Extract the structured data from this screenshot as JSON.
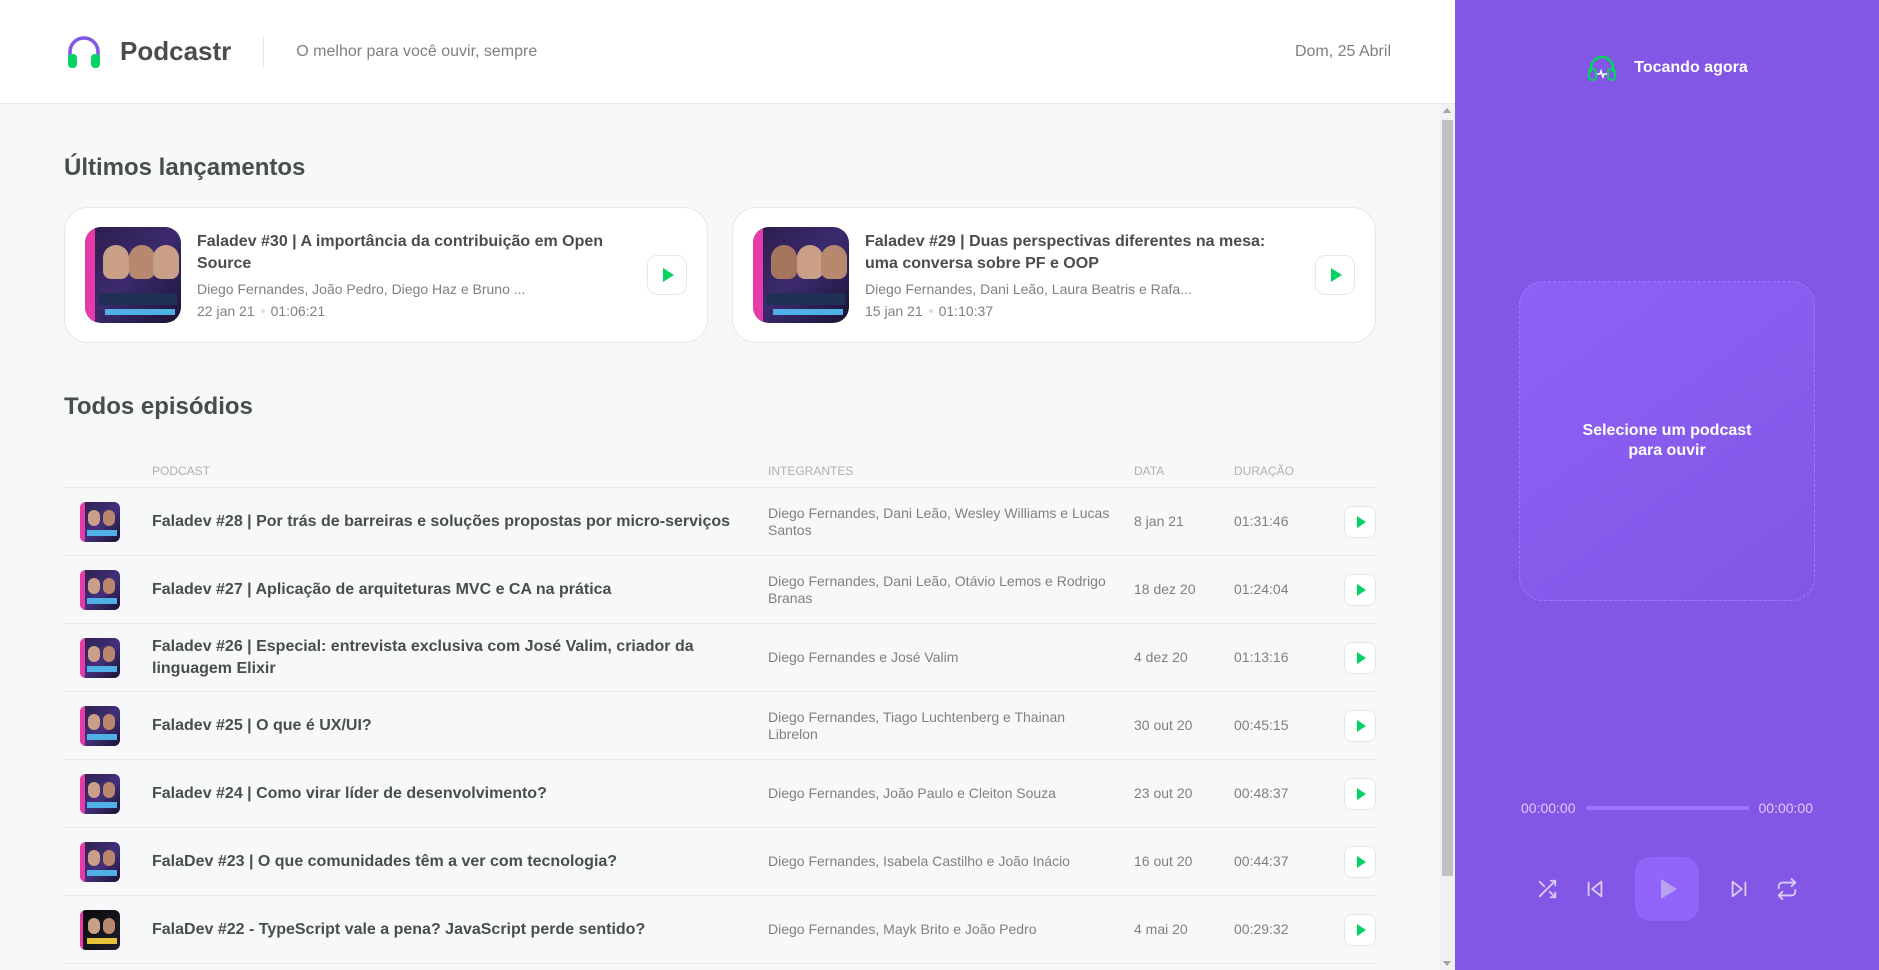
{
  "header": {
    "app_name": "Podcastr",
    "tagline": "O melhor para você ouvir, sempre",
    "date": "Dom, 25 Abril"
  },
  "latest": {
    "title": "Últimos lançamentos",
    "episodes": [
      {
        "title": "Faladev #30 | A importância da contribuição em Open Source",
        "members": "Diego Fernandes, João Pedro, Diego Haz e Bruno ...",
        "date": "22 jan 21",
        "duration": "01:06:21"
      },
      {
        "title": "Faladev #29 | Duas perspectivas diferentes na mesa: uma conversa sobre PF e OOP",
        "members": "Diego Fernandes, Dani Leão, Laura Beatris e Rafa...",
        "date": "15 jan 21",
        "duration": "01:10:37"
      }
    ]
  },
  "all": {
    "title": "Todos episódios",
    "headers": {
      "podcast": "Podcast",
      "members": "Integrantes",
      "date": "Data",
      "duration": "Duração"
    },
    "rows": [
      {
        "title": "Faladev #28 | Por trás de barreiras e soluções propostas por micro-serviços",
        "members": "Diego Fernandes, Dani Leão, Wesley Williams e Lucas Santos",
        "date": "8 jan 21",
        "duration": "01:31:46"
      },
      {
        "title": "Faladev #27 | Aplicação de arquiteturas MVC e CA na prática",
        "members": "Diego Fernandes, Dani Leão, Otávio Lemos e Rodrigo Branas",
        "date": "18 dez 20",
        "duration": "01:24:04"
      },
      {
        "title": "Faladev #26 | Especial: entrevista exclusiva com José Valim, criador da linguagem Elixir",
        "members": "Diego Fernandes e José Valim",
        "date": "4 dez 20",
        "duration": "01:13:16"
      },
      {
        "title": "Faladev #25 | O que é UX/UI?",
        "members": "Diego Fernandes, Tiago Luchtenberg e Thainan Librelon",
        "date": "30 out 20",
        "duration": "00:45:15"
      },
      {
        "title": "Faladev #24 | Como virar líder de desenvolvimento?",
        "members": "Diego Fernandes, João Paulo e Cleiton Souza",
        "date": "23 out 20",
        "duration": "00:48:37"
      },
      {
        "title": "FalaDev #23 | O que comunidades têm a ver com tecnologia?",
        "members": "Diego Fernandes, Isabela Castilho e João Inácio",
        "date": "16 out 20",
        "duration": "00:44:37"
      },
      {
        "title": "FalaDev #22 - TypeScript vale a pena? JavaScript perde sentido?",
        "members": "Diego Fernandes, Mayk Brito e João Pedro",
        "date": "4 mai 20",
        "duration": "00:29:32"
      }
    ]
  },
  "player": {
    "title": "Tocando agora",
    "empty_message": "Selecione um podcast para ouvir",
    "current_time": "00:00:00",
    "total_time": "00:00:00",
    "icons": [
      "headphones-icon",
      "shuffle-icon",
      "previous-icon",
      "play-icon",
      "next-icon",
      "repeat-icon"
    ]
  },
  "colors": {
    "brand_purple": "#8257e5",
    "play_green": "#04d361"
  }
}
